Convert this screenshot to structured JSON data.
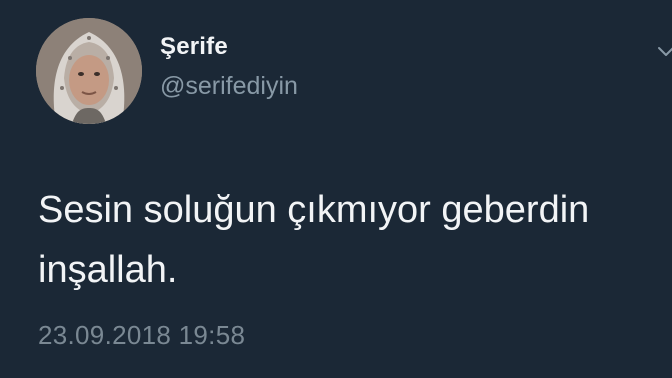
{
  "profile": {
    "display_name": "Şerife",
    "handle": "@serifediyin",
    "avatar_icon": "profile-photo"
  },
  "tweet": {
    "text": "Sesin soluğun çıkmıyor geberdin\ninşallah.",
    "timestamp": "23.09.2018 19:58"
  },
  "menu": {
    "icon": "chevron-down-icon"
  },
  "colors": {
    "background": "#1b2836",
    "text": "#f2f4f6",
    "secondary_text": "#8899a6"
  }
}
